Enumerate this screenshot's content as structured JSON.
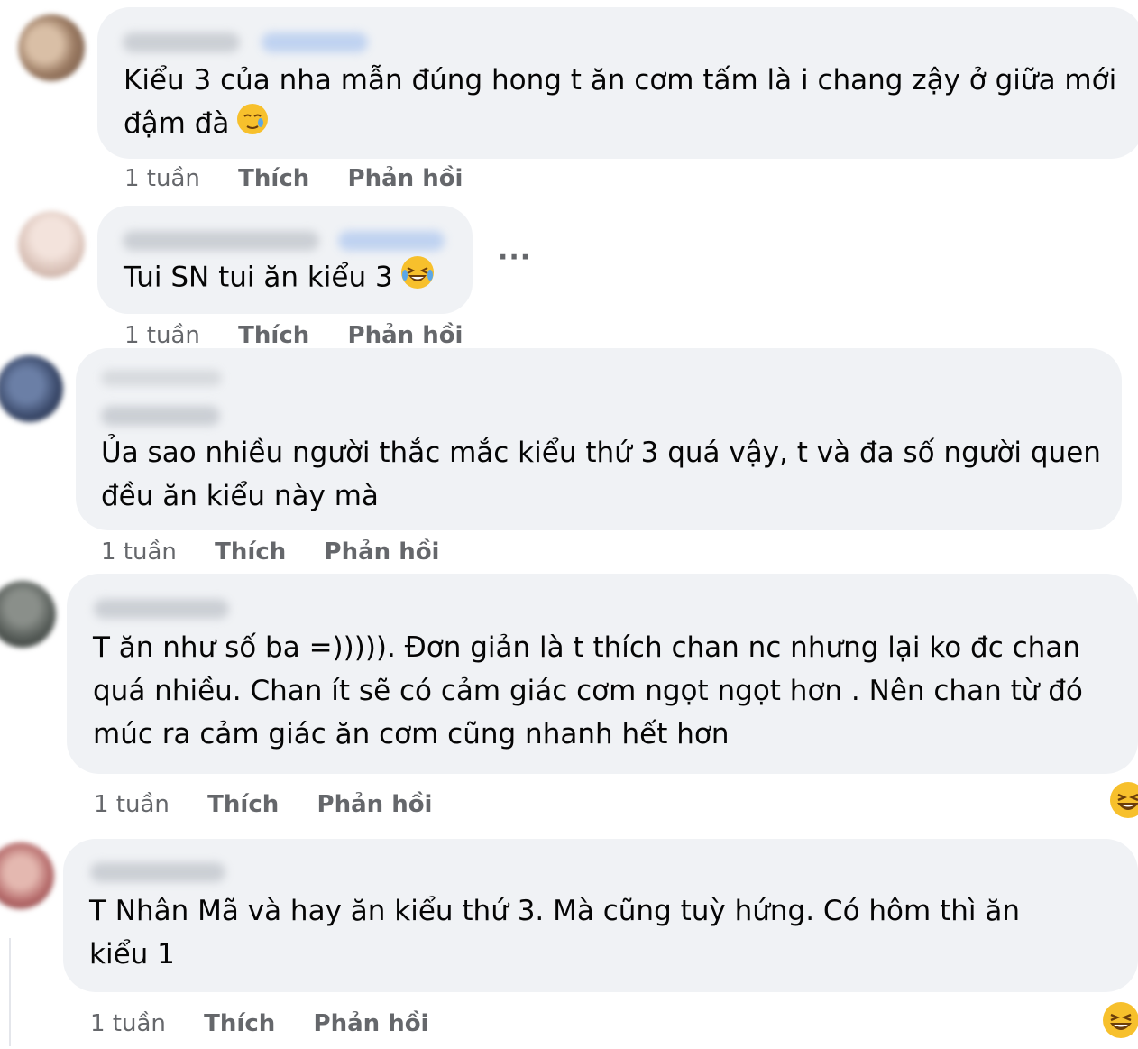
{
  "comments": [
    {
      "text_lines": [
        "Kiểu 3 của nha mẫn đúng hong t ăn cơm tấm là i chang zậy ở giữa mới",
        "đậm đà"
      ],
      "emoji": "sad-tear-smile-emoji",
      "time": "1 tuần",
      "like": "Thích",
      "reply": "Phản hồi"
    },
    {
      "text_lines": [
        "Tui SN tui ăn kiểu 3"
      ],
      "emoji": "laughing-tears-emoji",
      "more": "···",
      "time": "1 tuần",
      "like": "Thích",
      "reply": "Phản hồi"
    },
    {
      "text_lines": [
        "Ủa sao nhiều người thắc mắc kiểu thứ 3 quá vậy, t và đa số người quen",
        "đều ăn kiểu này mà"
      ],
      "time": "1 tuần",
      "like": "Thích",
      "reply": "Phản hồi"
    },
    {
      "text_lines": [
        "T ăn như số ba =))))). Đơn giản là t thích chan nc nhưng lại ko đc chan",
        "quá nhiều. Chan ít sẽ có cảm giác cơm ngọt ngọt hơn . Nên chan từ đó",
        "múc ra cảm giác ăn cơm cũng nhanh hết hơn"
      ],
      "reaction": "haha-reaction",
      "time": "1 tuần",
      "like": "Thích",
      "reply": "Phản hồi"
    },
    {
      "text_lines": [
        "T Nhân Mã và hay ăn kiểu thứ 3. Mà cũng tuỳ hứng. Có hôm thì ăn",
        "kiểu 1"
      ],
      "reaction": "haha-reaction",
      "time": "1 tuần",
      "like": "Thích",
      "reply": "Phản hồi"
    }
  ]
}
